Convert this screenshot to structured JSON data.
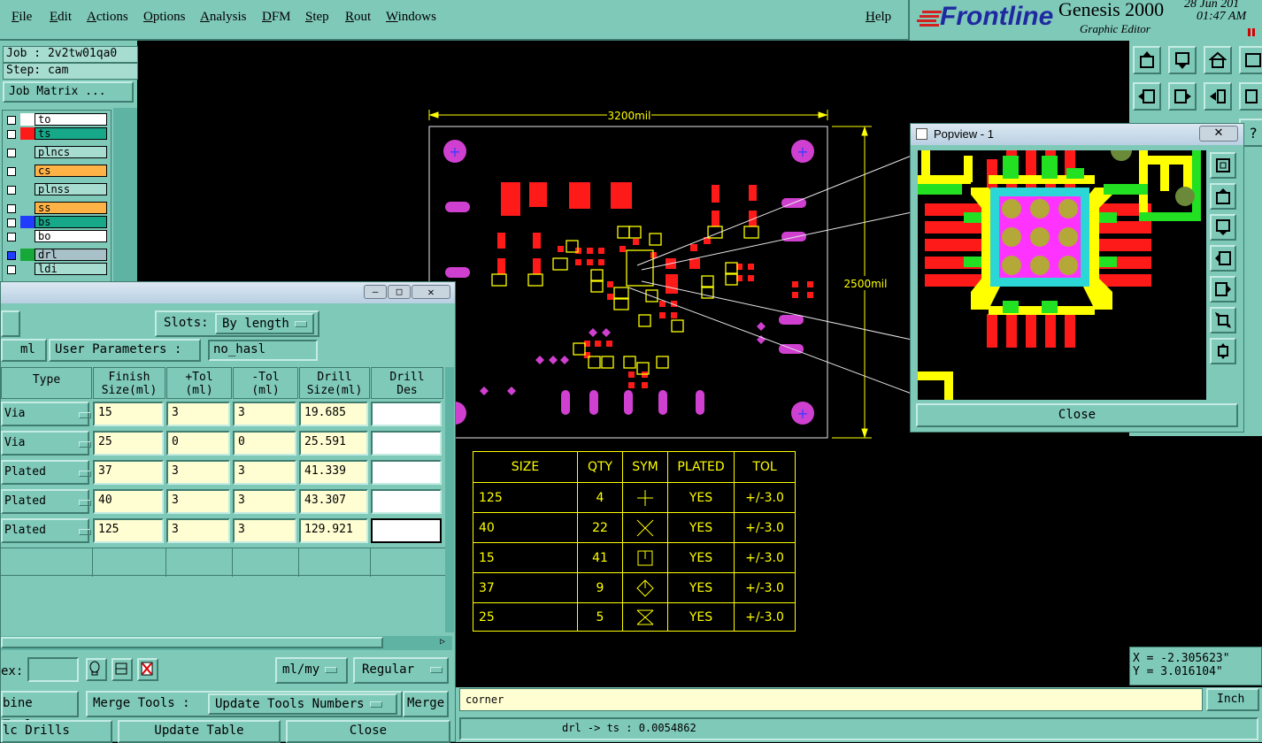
{
  "menubar": {
    "items": [
      "File",
      "Edit",
      "Actions",
      "Options",
      "Analysis",
      "DFM",
      "Step",
      "Rout",
      "Windows"
    ],
    "help": "Help"
  },
  "brand": {
    "logo": "Frontline",
    "product": "Genesis 2000",
    "subtitle": "Graphic Editor",
    "date": "28 Jun 201",
    "time": "01:47 AM"
  },
  "job": {
    "job_label": "Job : 2v2tw01qa0",
    "step_label": "Step: cam",
    "matrix_button": "Job Matrix ..."
  },
  "layers": [
    {
      "name": "to",
      "color": "#ffffff",
      "bg": "#ffffff"
    },
    {
      "name": "ts",
      "color": "#ff1a1a",
      "bg": "#17a88a"
    },
    {
      "name": "plncs",
      "color": "#7fc9b9",
      "bg": "#a7ddd1"
    },
    {
      "name": "cs",
      "color": "#7fc9b9",
      "bg": "#ffb347"
    },
    {
      "name": "plnss",
      "color": "#7fc9b9",
      "bg": "#a7ddd1"
    },
    {
      "name": "ss",
      "color": "#7fc9b9",
      "bg": "#ffb347"
    },
    {
      "name": "bs",
      "color": "#1f3cff",
      "bg": "#17a88a"
    },
    {
      "name": "bo",
      "color": "#7fc9b9",
      "bg": "#ffffff"
    },
    {
      "name": "drl",
      "color": "#17a83a",
      "bg": "#a8c0c8"
    },
    {
      "name": "ldi",
      "color": "#7fc9b9",
      "bg": "#a7ddd1"
    }
  ],
  "board": {
    "width_dim": "3200mil",
    "height_dim": "2500mil"
  },
  "drill_table": {
    "headers": [
      "SIZE",
      "QTY",
      "SYM",
      "PLATED",
      "TOL"
    ],
    "rows": [
      {
        "size": "125",
        "qty": "4",
        "sym": "plus",
        "plated": "YES",
        "tol": "+/-3.0"
      },
      {
        "size": "40",
        "qty": "22",
        "sym": "x",
        "plated": "YES",
        "tol": "+/-3.0"
      },
      {
        "size": "15",
        "qty": "41",
        "sym": "box",
        "plated": "YES",
        "tol": "+/-3.0"
      },
      {
        "size": "37",
        "qty": "9",
        "sym": "diamond",
        "plated": "YES",
        "tol": "+/-3.0"
      },
      {
        "size": "25",
        "qty": "5",
        "sym": "hourglass",
        "plated": "YES",
        "tol": "+/-3.0"
      }
    ]
  },
  "popview": {
    "title": "Popview - 1",
    "close": "Close"
  },
  "coords": {
    "x": "X = -2.305623\"",
    "y": "Y = 3.016104\""
  },
  "status": {
    "command": "corner",
    "units_button": "Inch",
    "message": "drl -> ts : 0.0054862"
  },
  "dialog": {
    "slots_label": "Slots:",
    "slots_value": "By length",
    "units_value": "ml",
    "user_params_label": "User Parameters :",
    "user_params_value": "no_hasl",
    "columns": [
      "Type",
      "Finish\nSize(ml)",
      "+Tol\n(ml)",
      "-Tol\n(ml)",
      "Drill\nSize(ml)",
      "Drill\nDes"
    ],
    "rows": [
      {
        "type": "Via",
        "finish": "15",
        "ptol": "3",
        "mtol": "3",
        "drill": "19.685",
        "des": ""
      },
      {
        "type": "Via",
        "finish": "25",
        "ptol": "0",
        "mtol": "0",
        "drill": "25.591",
        "des": ""
      },
      {
        "type": "Plated",
        "finish": "37",
        "ptol": "3",
        "mtol": "3",
        "drill": "41.339",
        "des": ""
      },
      {
        "type": "Plated",
        "finish": "40",
        "ptol": "3",
        "mtol": "3",
        "drill": "43.307",
        "des": ""
      },
      {
        "type": "Plated",
        "finish": "125",
        "ptol": "3",
        "mtol": "3",
        "drill": "129.921",
        "des": ""
      }
    ],
    "index_label": "ex:",
    "units_select": "ml/my",
    "mode_select": "Regular",
    "combine_tools": "bine Tools",
    "merge_tools_label": "Merge Tools :",
    "merge_tools_value": "Update Tools Numbers",
    "merge_button": "Merge",
    "calc_drills": "lc Drills",
    "update_table": "Update Table",
    "close": "Close"
  }
}
